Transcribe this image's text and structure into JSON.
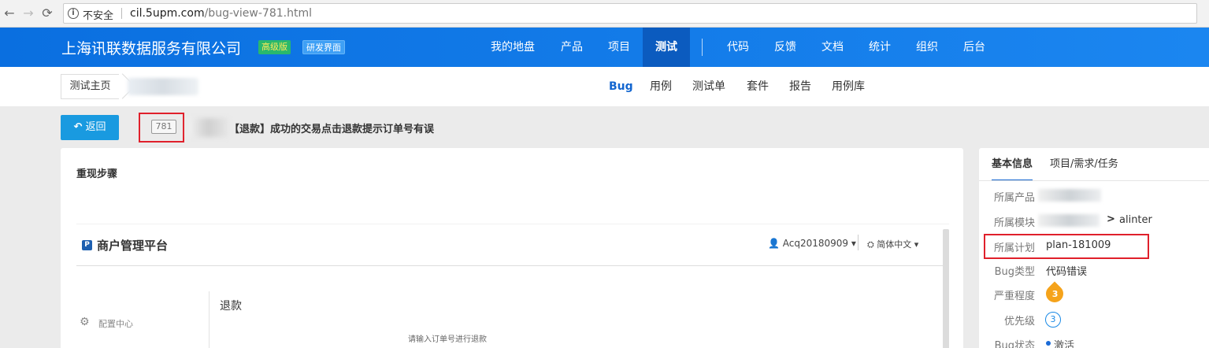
{
  "browser": {
    "insecure_label": "不安全",
    "url_host": "cil.5upm.com",
    "url_path": "/bug-view-781.html",
    "back": "←",
    "forward": "→",
    "reload": "⟳"
  },
  "header": {
    "company": "上海讯联数据服务有限公司",
    "badge_pro": "高级版",
    "badge_dev": "研发界面",
    "menu": [
      "我的地盘",
      "产品",
      "项目",
      "测试",
      "代码",
      "反馈",
      "文档",
      "统计",
      "组织",
      "后台"
    ],
    "active_menu": "测试"
  },
  "subnav": {
    "home": "测试主页",
    "tabs": [
      "Bug",
      "用例",
      "测试单",
      "套件",
      "报告",
      "用例库"
    ],
    "active_tab": "Bug"
  },
  "bug": {
    "back_label": "返回",
    "id": "781",
    "title": "【退款】成功的交易点击退款提示订单号有误"
  },
  "main": {
    "section_title": "重现步骤",
    "embedded": {
      "platform": "商户管理平台",
      "user": "Acq20180909 ▾",
      "lang": "简体中文 ▾",
      "config": "配置中心",
      "refund": "退款",
      "refund_hint": "请输入订单号进行退款"
    }
  },
  "side": {
    "tabs": [
      "基本信息",
      "项目/需求/任务"
    ],
    "fields": {
      "product_label": "所属产品",
      "module_label": "所属模块",
      "module_value": "alinter",
      "module_sep": ">",
      "plan_label": "所属计划",
      "plan_value": "plan-181009",
      "type_label": "Bug类型",
      "type_value": "代码错误",
      "severity_label": "严重程度",
      "severity_value": "3",
      "priority_label": "优先级",
      "priority_value": "3",
      "status_label": "Bug状态",
      "status_value": "激活"
    }
  },
  "colors": {
    "header_blue": "#0a6fe0",
    "active_blue": "#1366d0",
    "highlight_red": "#e0202b",
    "severity_orange": "#f5a31b"
  }
}
